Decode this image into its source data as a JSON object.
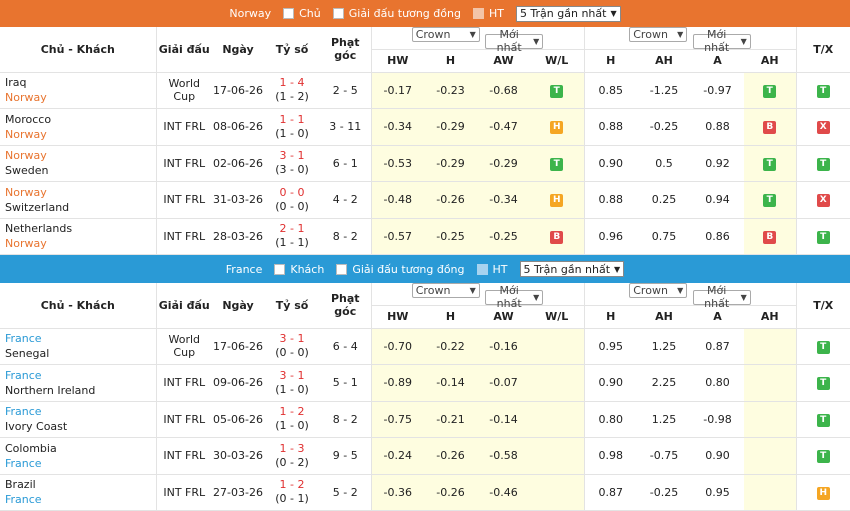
{
  "norway": {
    "team": "Norway",
    "opts": [
      "Chủ",
      "Giải đấu tương đồng",
      "HT"
    ],
    "select": "5 Trận gần nhất",
    "headers": {
      "teams": "Chủ - Khách",
      "league": "Giải đấu",
      "date": "Ngày",
      "score": "Tỷ số",
      "corner": "Phạt góc",
      "hw": "HW",
      "h": "H",
      "aw": "AW",
      "wl": "W/L",
      "h2": "H",
      "ah": "AH",
      "a": "A",
      "ah2": "AH",
      "tx": "T/X",
      "crown1": "Crown",
      "latest1": "Mới nhất",
      "crown2": "Crown",
      "latest2": "Mới nhất"
    },
    "rows": [
      {
        "home": "Iraq",
        "away": "Norway",
        "hl": "away",
        "league": "World Cup",
        "date": "17-06-26",
        "ft": "1 - 4",
        "ht": "(1 - 2)",
        "corner": "2 - 5",
        "hw": "-0.17",
        "h": "-0.23",
        "aw": "-0.68",
        "wl": "T",
        "h2": "0.85",
        "ah": "-1.25",
        "a": "-0.97",
        "ah2": "T",
        "tx": "T"
      },
      {
        "home": "Morocco",
        "away": "Norway",
        "hl": "away",
        "league": "INT FRL",
        "date": "08-06-26",
        "ft": "1 - 1",
        "ht": "(1 - 0)",
        "corner": "3 - 11",
        "hw": "-0.34",
        "h": "-0.29",
        "aw": "-0.47",
        "wl": "H",
        "h2": "0.88",
        "ah": "-0.25",
        "a": "0.88",
        "ah2": "B",
        "tx": "X"
      },
      {
        "home": "Norway",
        "away": "Sweden",
        "hl": "home",
        "league": "INT FRL",
        "date": "02-06-26",
        "ft": "3 - 1",
        "ht": "(3 - 0)",
        "corner": "6 - 1",
        "hw": "-0.53",
        "h": "-0.29",
        "aw": "-0.29",
        "wl": "T",
        "h2": "0.90",
        "ah": "0.5",
        "a": "0.92",
        "ah2": "T",
        "tx": "T"
      },
      {
        "home": "Norway",
        "away": "Switzerland",
        "hl": "home",
        "league": "INT FRL",
        "date": "31-03-26",
        "ft": "0 - 0",
        "ht": "(0 - 0)",
        "corner": "4 - 2",
        "hw": "-0.48",
        "h": "-0.26",
        "aw": "-0.34",
        "wl": "H",
        "h2": "0.88",
        "ah": "0.25",
        "a": "0.94",
        "ah2": "T",
        "tx": "X"
      },
      {
        "home": "Netherlands",
        "away": "Norway",
        "hl": "away",
        "league": "INT FRL",
        "date": "28-03-26",
        "ft": "2 - 1",
        "ht": "(1 - 1)",
        "corner": "8 - 2",
        "hw": "-0.57",
        "h": "-0.25",
        "aw": "-0.25",
        "wl": "B",
        "h2": "0.96",
        "ah": "0.75",
        "a": "0.86",
        "ah2": "B",
        "tx": "T"
      }
    ]
  },
  "france": {
    "team": "France",
    "opts": [
      "Khách",
      "Giải đấu tương đồng",
      "HT"
    ],
    "select": "5 Trận gần nhất",
    "headers": {
      "teams": "Chủ - Khách",
      "league": "Giải đấu",
      "date": "Ngày",
      "score": "Tỷ số",
      "corner": "Phạt góc",
      "hw": "HW",
      "h": "H",
      "aw": "AW",
      "wl": "W/L",
      "h2": "H",
      "ah": "AH",
      "a": "A",
      "ah2": "AH",
      "tx": "T/X",
      "crown1": "Crown",
      "latest1": "Mới nhất",
      "crown2": "Crown",
      "latest2": "Mới nhất"
    },
    "rows": [
      {
        "home": "France",
        "away": "Senegal",
        "hl": "home",
        "league": "World Cup",
        "date": "17-06-26",
        "ft": "3 - 1",
        "ht": "(0 - 0)",
        "corner": "6 - 4",
        "hw": "-0.70",
        "h": "-0.22",
        "aw": "-0.16",
        "wl": "",
        "h2": "0.95",
        "ah": "1.25",
        "a": "0.87",
        "ah2": "",
        "tx": "T"
      },
      {
        "home": "France",
        "away": "Northern Ireland",
        "hl": "home",
        "league": "INT FRL",
        "date": "09-06-26",
        "ft": "3 - 1",
        "ht": "(1 - 0)",
        "corner": "5 - 1",
        "hw": "-0.89",
        "h": "-0.14",
        "aw": "-0.07",
        "wl": "",
        "h2": "0.90",
        "ah": "2.25",
        "a": "0.80",
        "ah2": "",
        "tx": "T"
      },
      {
        "home": "France",
        "away": "Ivory Coast",
        "hl": "home",
        "league": "INT FRL",
        "date": "05-06-26",
        "ft": "1 - 2",
        "ht": "(1 - 0)",
        "corner": "8 - 2",
        "hw": "-0.75",
        "h": "-0.21",
        "aw": "-0.14",
        "wl": "",
        "h2": "0.80",
        "ah": "1.25",
        "a": "-0.98",
        "ah2": "",
        "tx": "T"
      },
      {
        "home": "Colombia",
        "away": "France",
        "hl": "away",
        "league": "INT FRL",
        "date": "30-03-26",
        "ft": "1 - 3",
        "ht": "(0 - 2)",
        "corner": "9 - 5",
        "hw": "-0.24",
        "h": "-0.26",
        "aw": "-0.58",
        "wl": "",
        "h2": "0.98",
        "ah": "-0.75",
        "a": "0.90",
        "ah2": "",
        "tx": "T"
      },
      {
        "home": "Brazil",
        "away": "France",
        "hl": "away",
        "league": "INT FRL",
        "date": "27-03-26",
        "ft": "1 - 2",
        "ht": "(0 - 1)",
        "corner": "5 - 2",
        "hw": "-0.36",
        "h": "-0.26",
        "aw": "-0.46",
        "wl": "",
        "h2": "0.87",
        "ah": "-0.25",
        "a": "0.95",
        "ah2": "",
        "tx": "H"
      }
    ]
  }
}
